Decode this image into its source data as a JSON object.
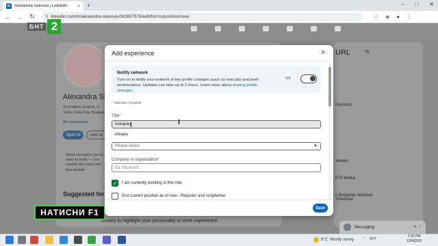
{
  "browser": {
    "tab_title": "Alexandra Slavova | LinkedIn",
    "tab_close": "×",
    "new_tab": "+",
    "url": "linkedin.com/in/alexandra-slavova-0b2807376/edit/forms/position/new/",
    "win_min": "–",
    "win_max": "□",
    "win_close": "✕"
  },
  "tv": {
    "logo_text": "БНТ",
    "logo_number": "2",
    "tag_text": "НАТИСНИ",
    "tag_f1": "F1"
  },
  "background_page": {
    "name": "Alexandra Sla",
    "subtitle": "Journalism student, S",
    "location": "Sofia, Sofia City, Bulgaria",
    "connections": "96 connections",
    "open_btn": "Open to",
    "add_btn": "Add se",
    "show_recruiters": "Show recruiters you're open to work — you control who sees this",
    "get_started": "Get started",
    "suggested": "Suggested for yo",
    "summary": "mmary to highlight your personality or work experience",
    "right_url": "URL",
    "right_premium": "Premium",
    "right_viewed": "viewed",
    "right_btv": "bTV Media",
    "right_bnt": "n Bulgarian National Television"
  },
  "modal": {
    "title": "Add experience",
    "notify_title": "Notify network",
    "notify_text": "Turn on to notify your network of key profile changes (such as new job) and work anniversaries. Updates can take up to 2 hours. Learn more about ",
    "notify_link": "sharing profile changes.",
    "toggle_state": "Off",
    "required_note": "* Indicates required",
    "title_label": "Title*",
    "title_value": "специал",
    "suggestion": "специа",
    "employment_placeholder": "Please select",
    "company_label": "Company or organization*",
    "company_placeholder": "Ex: Microsoft",
    "currently_working": "I am currently working in this role",
    "end_current": "End current position as of now - Reporter and scriptwriter",
    "save": "Save",
    "close": "×"
  },
  "messaging": {
    "label": "Messaging",
    "controls": "··· ✎ ⌃"
  },
  "taskbar": {
    "weather_temp": "8°C",
    "weather_text": "Mostly sunny",
    "lang": "БГР",
    "time": "2:32 PM",
    "date": "12/9/2025"
  },
  "colors": {
    "accent": "#0a66c2",
    "check_green": "#057642",
    "tv_green": "#2aa532"
  }
}
